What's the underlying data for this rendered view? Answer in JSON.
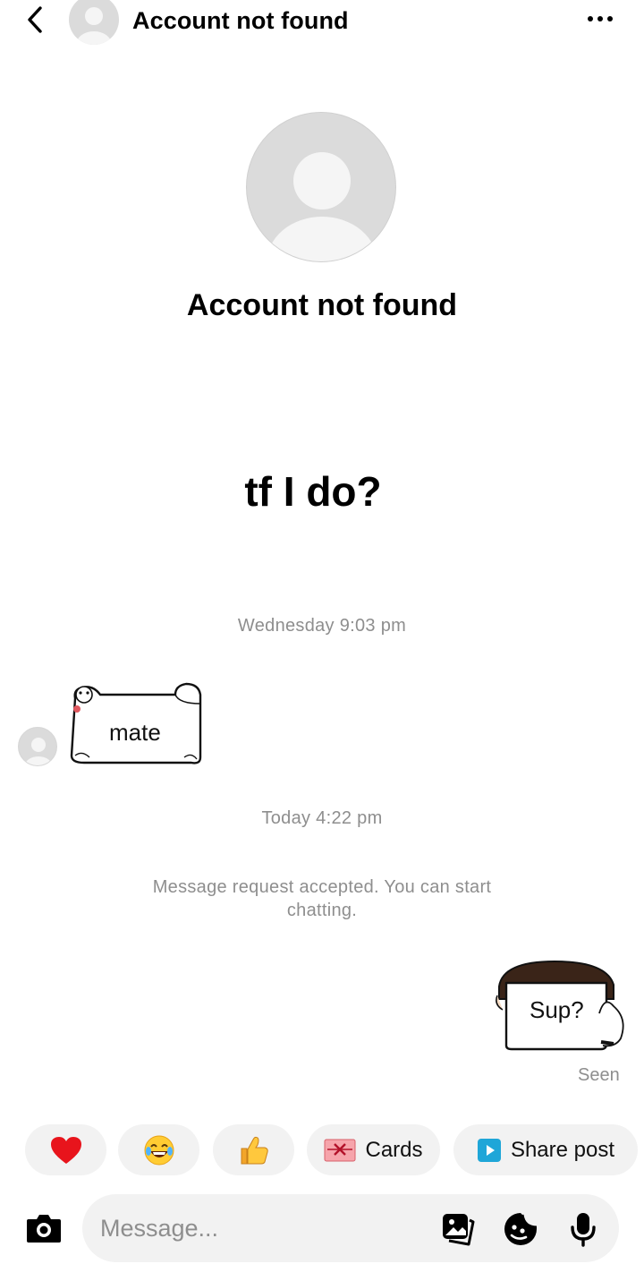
{
  "header": {
    "title": "Account not found"
  },
  "profile": {
    "name": "Account not found"
  },
  "overlay_text": "tf I do?",
  "conversation": {
    "timestamp_1": "Wednesday 9:03 pm",
    "received_sticker_text": "mate",
    "timestamp_2": "Today 4:22 pm",
    "system_message": "Message request accepted. You can start chatting.",
    "sent_sticker_text": "Sup?",
    "seen_label": "Seen"
  },
  "quick_replies": {
    "heart": "❤️",
    "laugh": "😂",
    "thumbs_up": "👍",
    "cards_label": "Cards",
    "share_post_label": "Share post"
  },
  "composer": {
    "placeholder": "Message..."
  },
  "colors": {
    "background": "#ffffff",
    "chip": "#f2f2f2",
    "muted_text": "#8e8e8e",
    "avatar": "#dbdbdb",
    "share_icon": "#1fa6d8",
    "cards_icon": "#f3a0a6"
  },
  "icons": [
    "back-icon",
    "more-icon",
    "camera-icon",
    "gallery-icon",
    "sticker-icon",
    "microphone-icon"
  ]
}
